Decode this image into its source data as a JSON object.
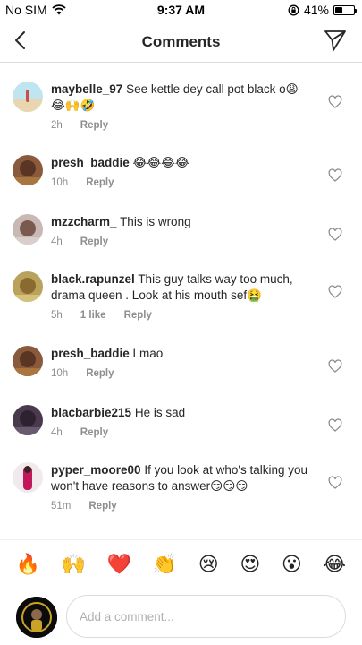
{
  "status_bar": {
    "carrier": "No SIM",
    "time": "9:37 AM",
    "battery": "41%",
    "battery_level": 0.41
  },
  "header": {
    "title": "Comments"
  },
  "comments": [
    {
      "username": "maybelle_97",
      "text": "See kettle dey call pot black o😩😂🙌🤣",
      "time": "2h",
      "likes": "",
      "reply": "Reply"
    },
    {
      "username": "presh_baddie",
      "text": "😂😂😂😂",
      "time": "10h",
      "likes": "",
      "reply": "Reply"
    },
    {
      "username": "mzzcharm_",
      "text": "This is wrong",
      "time": "4h",
      "likes": "",
      "reply": "Reply"
    },
    {
      "username": "black.rapunzel",
      "text": "This guy talks way too much, drama queen . Look at his mouth sef🤮",
      "time": "5h",
      "likes": "1 like",
      "reply": "Reply"
    },
    {
      "username": "presh_baddie",
      "text": "Lmao",
      "time": "10h",
      "likes": "",
      "reply": "Reply"
    },
    {
      "username": "blacbarbie215",
      "text": "He is sad",
      "time": "4h",
      "likes": "",
      "reply": "Reply"
    },
    {
      "username": "pyper_moore00",
      "text": "If you look at who's talking you won't have reasons to answer😏😏😏",
      "time": "51m",
      "likes": "",
      "reply": "Reply"
    }
  ],
  "quick_reactions": [
    "🔥",
    "🙌",
    "❤️",
    "👏",
    "😢",
    "😍",
    "😮",
    "😂"
  ],
  "composer": {
    "placeholder": "Add a comment..."
  }
}
